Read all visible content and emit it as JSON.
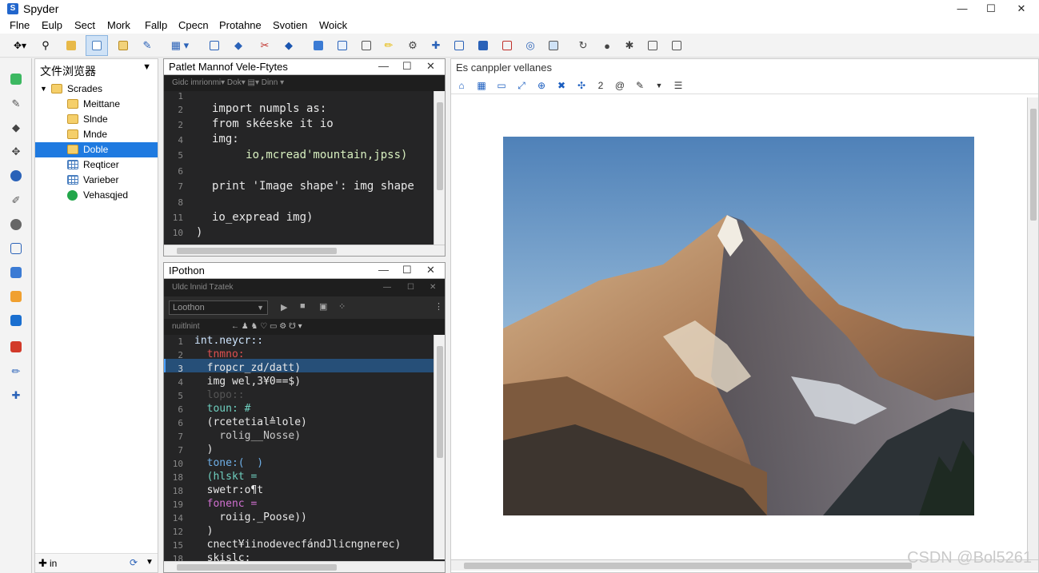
{
  "app": {
    "title": "Spyder",
    "win_min": "—",
    "win_max": "☐",
    "win_close": "✕"
  },
  "menu": [
    "Flne",
    "Eulp",
    "Sect",
    "Mork",
    "Fallp",
    "Cpecn",
    "Protahne",
    "Svotien",
    "Woick"
  ],
  "file_browser": {
    "title": "文件浏览器",
    "root": "Scrades",
    "items": [
      {
        "label": "Meittane",
        "type": "folder"
      },
      {
        "label": "Slnde",
        "type": "folder"
      },
      {
        "label": "Mnde",
        "type": "folder"
      },
      {
        "label": "Doble",
        "type": "folder",
        "selected": true
      },
      {
        "label": "Reqticer",
        "type": "grid"
      },
      {
        "label": "Varieber",
        "type": "grid"
      },
      {
        "label": "Vehasqjed",
        "type": "ok"
      }
    ],
    "bottom_label": "in"
  },
  "editor": {
    "title": "Patlet Mannof Vele-Ftytes",
    "subbar": "Gidc imrionmi▾   Dok▾   ▤▾   Dinn ▾",
    "lines": [
      {
        "n": "1",
        "text": ""
      },
      {
        "n": "2",
        "text": "import numpls as:"
      },
      {
        "n": "2",
        "text": "from skéeske it io"
      },
      {
        "n": "4",
        "text": "img:"
      },
      {
        "n": "5",
        "text": "     io,mcread'mountain,jpss)"
      },
      {
        "n": "6",
        "text": ""
      },
      {
        "n": "7",
        "text": "print 'Image shape': img shape"
      },
      {
        "n": "8",
        "text": ""
      },
      {
        "n": "11",
        "text": "io_expread img)"
      },
      {
        "n": "10",
        "text": ")"
      }
    ]
  },
  "ipython": {
    "title": "IPothon",
    "subbar": "Uldc lnnid  Tzatek",
    "env_select": "Loothon",
    "sub_toolbar_label": "nuitlnint",
    "lines": [
      {
        "n": "1",
        "text": "int.neycr::"
      },
      {
        "n": "2",
        "text": "  tnmno:"
      },
      {
        "n": "3",
        "text": "  fropcr_zd/datt)",
        "highlight": true
      },
      {
        "n": "4",
        "text": "  img wel,3¥0==$)"
      },
      {
        "n": "5",
        "text": "  lopo::"
      },
      {
        "n": "6",
        "text": "  toun: #"
      },
      {
        "n": "6",
        "text": "  (rcetetial≜lole)"
      },
      {
        "n": "7",
        "text": "    rolig__Nosse)"
      },
      {
        "n": "7",
        "text": "  )"
      },
      {
        "n": "10",
        "text": "  tone:(  )"
      },
      {
        "n": "18",
        "text": "  (hlskt ="
      },
      {
        "n": "18",
        "text": "  swetr:o¶t"
      },
      {
        "n": "19",
        "text": "  fonenc ="
      },
      {
        "n": "14",
        "text": "    roiig._Poose))"
      },
      {
        "n": "12",
        "text": "  )"
      },
      {
        "n": "15",
        "text": "  cnect¥iinodevecfándJlicngnerec)"
      },
      {
        "n": "18",
        "text": "  skislc:"
      }
    ]
  },
  "plots": {
    "title": "Es canppler vellanes",
    "toolbar_number": "2"
  },
  "watermark": "CSDN @Bol5261",
  "colors": {
    "accent": "#1f7ae0",
    "code_bg": "#252526",
    "highlight": "#264f78"
  }
}
